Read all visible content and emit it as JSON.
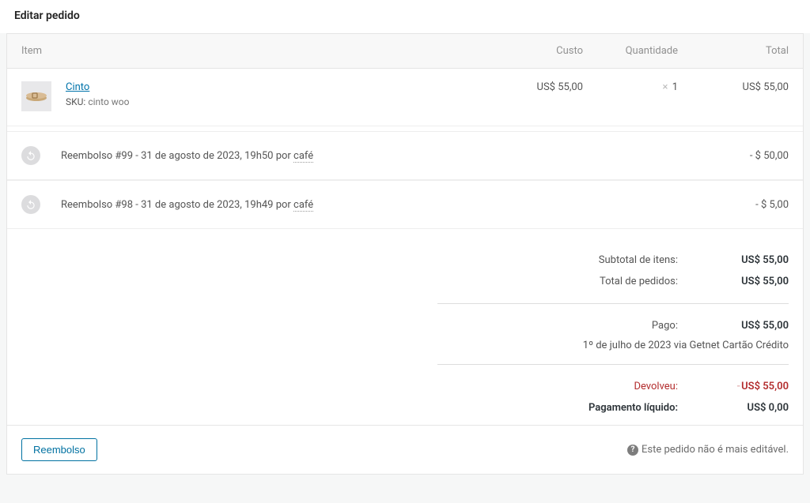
{
  "page_title": "Editar pedido",
  "headers": {
    "item": "Item",
    "cost": "Custo",
    "qty": "Quantidade",
    "total": "Total"
  },
  "line_item": {
    "name": "Cinto",
    "sku_label": "SKU:",
    "sku": "cinto woo",
    "cost": "US$ 55,00",
    "qty_prefix": "×",
    "qty": "1",
    "total": "US$ 55,00"
  },
  "refunds": [
    {
      "prefix": "Reembolso #99 - 31 de agosto de 2023, 19h50 por ",
      "author": "café",
      "amount": "- $ 50,00"
    },
    {
      "prefix": "Reembolso #98 - 31 de agosto de 2023, 19h49 por ",
      "author": "café",
      "amount": "- $ 5,00"
    }
  ],
  "totals": {
    "subtotal_label": "Subtotal de itens:",
    "subtotal_value": "US$ 55,00",
    "orders_total_label": "Total de pedidos:",
    "orders_total_value": "US$ 55,00",
    "paid_label": "Pago:",
    "paid_value": "US$ 55,00",
    "paid_method": "1º de julho de 2023 via Getnet Cartão Crédito",
    "returned_label": "Devolveu:",
    "returned_neg": "-",
    "returned_value": "US$ 55,00",
    "net_label": "Pagamento líquido:",
    "net_value": "US$ 0,00"
  },
  "footer": {
    "refund_button": "Reembolso",
    "not_editable": "Este pedido não é mais editável."
  }
}
